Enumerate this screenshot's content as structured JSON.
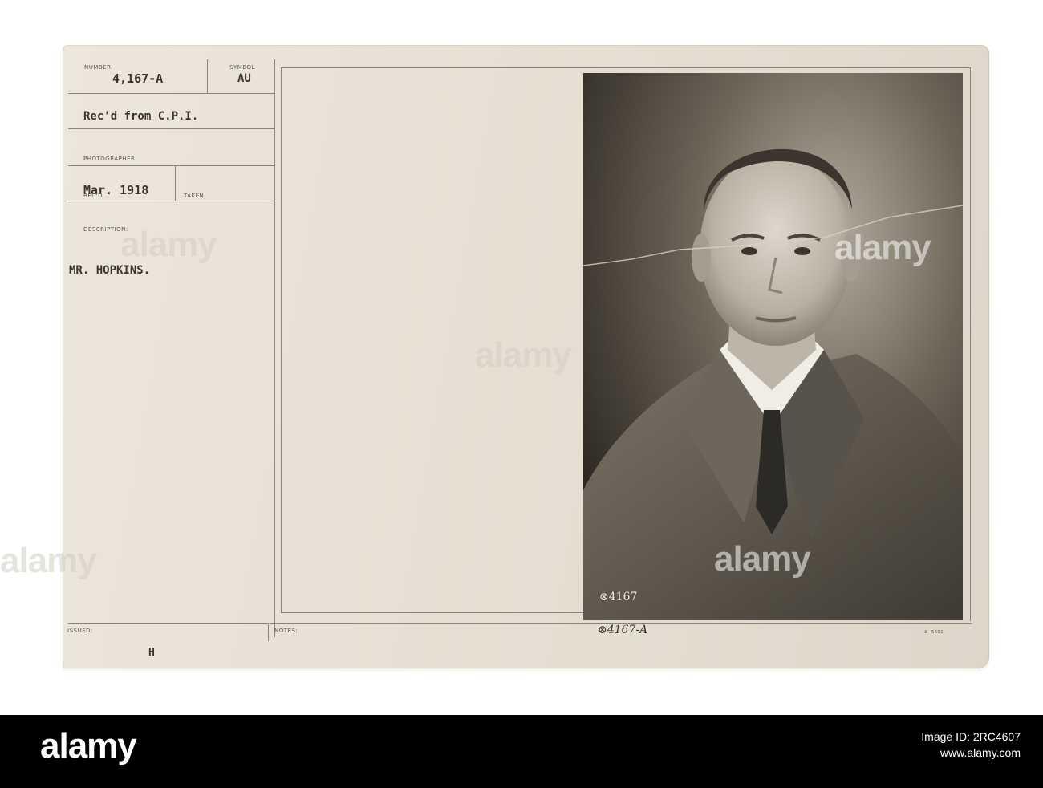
{
  "record": {
    "number_label": "NUMBER",
    "number_value": "4,167-A",
    "symbol_label": "SYMBOL",
    "symbol_value": "AU",
    "received_from": "Rec'd from C.P.I.",
    "photographer_label": "PHOTOGRAPHER",
    "date_value": "Mar. 1918",
    "recd_label": "REC'D",
    "taken_label": "TAKEN",
    "description_label": "DESCRIPTION:",
    "description_value": "MR. HOPKINS.",
    "issued_label": "ISSUED:",
    "issued_mark": "H",
    "notes_label": "NOTES:",
    "form_code": "3—5602"
  },
  "photo": {
    "negative_number": "⊗4167",
    "handwritten_number": "⊗4167-A"
  },
  "watermark": {
    "text": "alamy"
  },
  "footer": {
    "logo": "alamy",
    "image_id_label": "Image ID: 2RC4607",
    "site": "www.alamy.com"
  }
}
